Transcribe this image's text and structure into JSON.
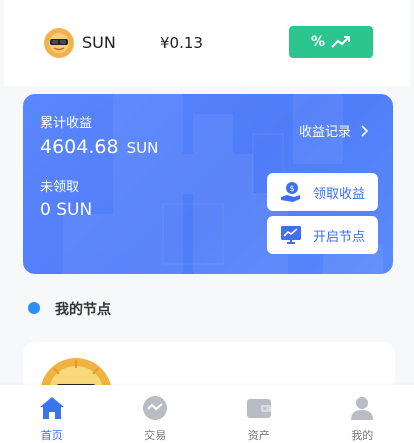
{
  "token": {
    "name": "SUN",
    "price": "¥0.13",
    "rate_button_symbol": "%",
    "rate_icon": "trend-up-icon",
    "colors": {
      "rate_button": "#2cc58e"
    }
  },
  "earnings": {
    "total_label": "累计收益",
    "total_amount": "4604.68",
    "total_unit": "SUN",
    "unclaimed_label": "未领取",
    "unclaimed_amount": "0",
    "unclaimed_unit": "SUN",
    "records_label": "收益记录",
    "claim_button": "领取收益",
    "claim_icon": "coin-hand-icon",
    "open_node_button": "开启节点",
    "open_node_icon": "chart-board-icon",
    "colors": {
      "card_bg": "#4f7cf8",
      "button_text": "#3f6ff0"
    }
  },
  "section": {
    "title": "我的节点",
    "dot_color": "#2a8ff0"
  },
  "nav": {
    "items": [
      {
        "label": "首页",
        "icon": "home-icon",
        "active": true
      },
      {
        "label": "交易",
        "icon": "exchange-icon",
        "active": false
      },
      {
        "label": "资产",
        "icon": "wallet-icon",
        "active": false
      },
      {
        "label": "我的",
        "icon": "user-icon",
        "active": false
      }
    ],
    "colors": {
      "active": "#3a74f0",
      "inactive": "#b9bcc4"
    }
  }
}
